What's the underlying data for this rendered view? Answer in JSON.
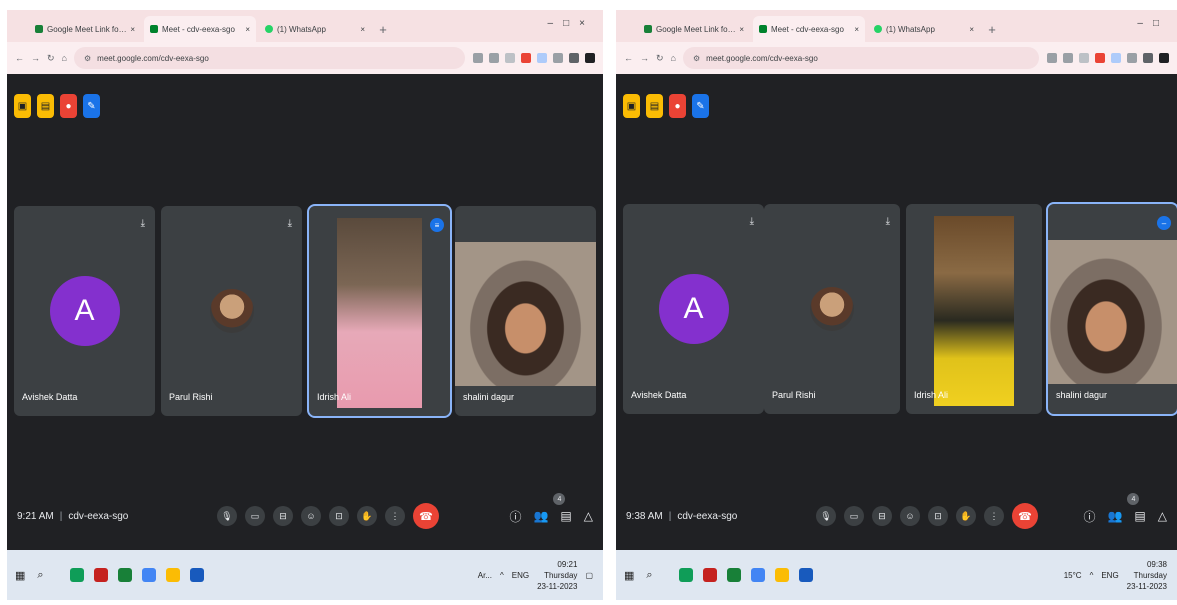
{
  "left": {
    "browser": {
      "tabs": [
        {
          "title": "Google Meet Link for Phase 1",
          "favicon_color": "#188038"
        },
        {
          "title": "Meet - cdv-eexa-sgo",
          "favicon_color": "#00832d"
        },
        {
          "title": "(1) WhatsApp",
          "favicon_color": "#25d366"
        }
      ],
      "new_tab": "+",
      "url": "meet.google.com/cdv-eexa-sgo"
    },
    "participants": [
      {
        "name": "Avishek Datta",
        "avatar": "A"
      },
      {
        "name": "Parul Rishi",
        "avatar": ""
      },
      {
        "name": "Idrish Ali",
        "avatar": ""
      },
      {
        "name": "shalini dagur",
        "avatar": ""
      }
    ],
    "time": "9:21 AM",
    "meeting_code": "cdv-eexa-sgo",
    "people_count": "4",
    "taskbar": {
      "tray_text": "Ar...",
      "language": "ENG",
      "clock_time": "09:21",
      "clock_day": "Thursday",
      "clock_date": "23-11-2023"
    }
  },
  "right": {
    "browser": {
      "tabs": [
        {
          "title": "Google Meet Link for Phase 1",
          "favicon_color": "#188038"
        },
        {
          "title": "Meet - cdv-eexa-sgo",
          "favicon_color": "#00832d"
        },
        {
          "title": "(1) WhatsApp",
          "favicon_color": "#25d366"
        }
      ],
      "new_tab": "+",
      "url": "meet.google.com/cdv-eexa-sgo"
    },
    "participants": [
      {
        "name": "Avishek Datta",
        "avatar": "A"
      },
      {
        "name": "Parul Rishi",
        "avatar": ""
      },
      {
        "name": "Idrish Ali",
        "avatar": ""
      },
      {
        "name": "shalini dagur",
        "avatar": ""
      }
    ],
    "time": "9:38 AM",
    "meeting_code": "cdv-eexa-sgo",
    "people_count": "4",
    "taskbar": {
      "tray_text": "15°C",
      "language": "ENG",
      "clock_time": "09:38",
      "clock_day": "Thursday",
      "clock_date": "23-11-2023"
    }
  },
  "colors": {
    "meet_background": "#202124",
    "tile_background": "#3c4043",
    "active_speaker_border": "#8ab4f8",
    "end_call": "#ea4335",
    "avatar_purple": "#8430ce",
    "taskbar": "#dfe7f1"
  },
  "icons": {
    "host_controls": [
      "host-controls-icon",
      "lock-meeting-icon",
      "record-icon",
      "notes-icon"
    ],
    "controls": [
      "mic-icon",
      "camera-icon",
      "captions-icon",
      "emoji-icon",
      "present-icon",
      "raise-hand-icon",
      "more-options-icon",
      "end-call-icon"
    ],
    "right_controls": [
      "info-icon",
      "people-icon",
      "chat-icon",
      "activities-icon"
    ]
  }
}
